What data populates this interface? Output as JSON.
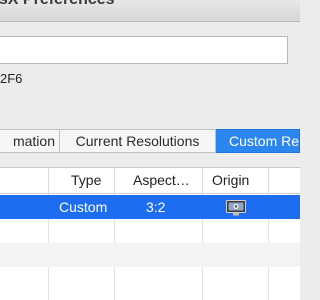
{
  "window": {
    "title": "esX Preferences"
  },
  "field": {
    "value": ""
  },
  "info_text": "2F6",
  "tabs": [
    {
      "label": "mation",
      "selected": false
    },
    {
      "label": "Current Resolutions",
      "selected": false
    },
    {
      "label": "Custom Re",
      "selected": true
    }
  ],
  "table": {
    "columns": [
      "",
      "Type",
      "Aspect…",
      "Origin",
      ""
    ],
    "rows": [
      {
        "type": "Custom",
        "aspect": "3:2",
        "origin_icon": "display-icon",
        "selected": true
      }
    ]
  },
  "colors": {
    "accent": "#2b86f0",
    "selection": "#1e6cf0"
  }
}
